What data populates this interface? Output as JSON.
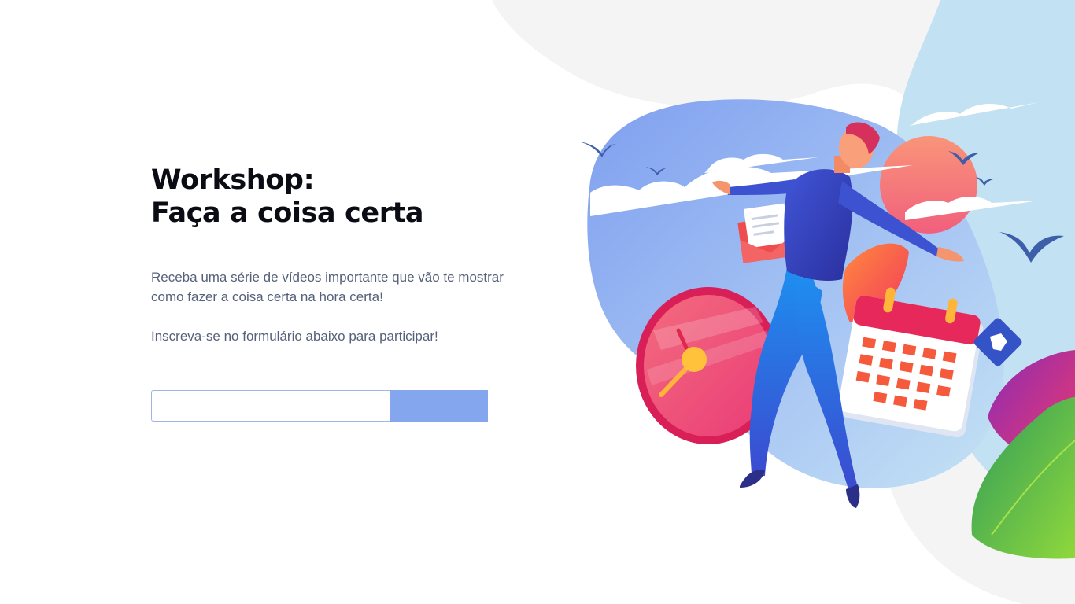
{
  "hero": {
    "title_line1": "Workshop:",
    "title_line2": "Faça a coisa certa",
    "description_line1": "Receba uma série de vídeos importante que vão te mostrar como fazer a coisa certa na hora certa!",
    "description_line2": "Inscreva-se no formulário abaixo para participar!"
  },
  "form": {
    "email_value": "",
    "email_placeholder": "",
    "submit_label": ""
  },
  "colors": {
    "title": "#0b0b14",
    "body_text": "#55607a",
    "button": "#84a6ef",
    "input_border": "#9fb5e6"
  },
  "illustration": {
    "icons": [
      "man-figure",
      "clock-icon",
      "calendar-icon",
      "envelope-icon",
      "cursor-icon",
      "bird-icons",
      "sun",
      "clouds",
      "leaves"
    ]
  }
}
